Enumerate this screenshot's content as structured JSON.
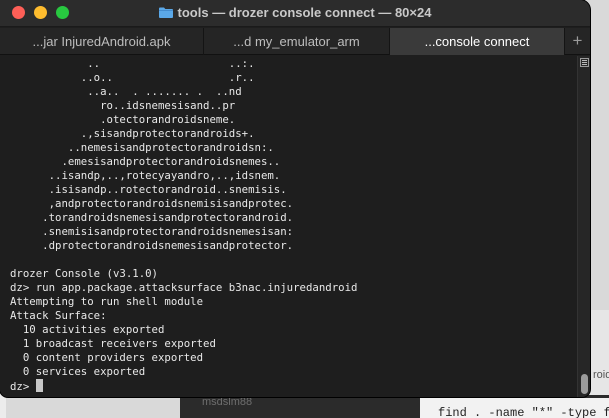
{
  "window": {
    "title": "tools — drozer console connect — 80×24",
    "folder_icon": "folder-icon"
  },
  "tabs": [
    {
      "label": "...jar InjuredAndroid.apk",
      "active": false
    },
    {
      "label": "...d my_emulator_arm",
      "active": false
    },
    {
      "label": "...console connect",
      "active": true
    }
  ],
  "new_tab_label": "+",
  "terminal": {
    "lines": [
      "            ..                    ..:.",
      "           ..o..                  .r..",
      "            ..a..  . ....... .  ..nd",
      "              ro..idsnemesisand..pr",
      "              .otectorandroidsneme.",
      "           .,sisandprotectorandroids+.",
      "         ..nemesisandprotectorandroidsn:.",
      "        .emesisandprotectorandroidsnemes..",
      "      ..isandp,..,rotecyayandro,..,idsnem.",
      "      .isisandp..rotectorandroid..snemisis.",
      "      ,andprotectorandroidsnemisisandprotec.",
      "     .torandroidsnemesisandprotectorandroid.",
      "     .snemisisandprotectorandroidsnemesisan:",
      "     .dprotectorandroidsnemesisandprotector.",
      "",
      "drozer Console (v3.1.0)",
      "dz> run app.package.attacksurface b3nac.injuredandroid",
      "Attempting to run shell module",
      "Attack Surface:",
      "  10 activities exported",
      "  1 broadcast receivers exported",
      "  0 content providers exported",
      "  0 services exported"
    ],
    "prompt": "dz> "
  },
  "background": {
    "left_fragment": "s",
    "bottom_fragment": "msdslm88",
    "bottom_white_fragment": "find . -name \"*\" -type f -",
    "right_fragment": "roid"
  },
  "colors": {
    "close": "#fe5f57",
    "minimize": "#febc2e",
    "zoom": "#28c840",
    "terminal_bg": "#1e1e1e",
    "terminal_fg": "#e8e8e8"
  }
}
